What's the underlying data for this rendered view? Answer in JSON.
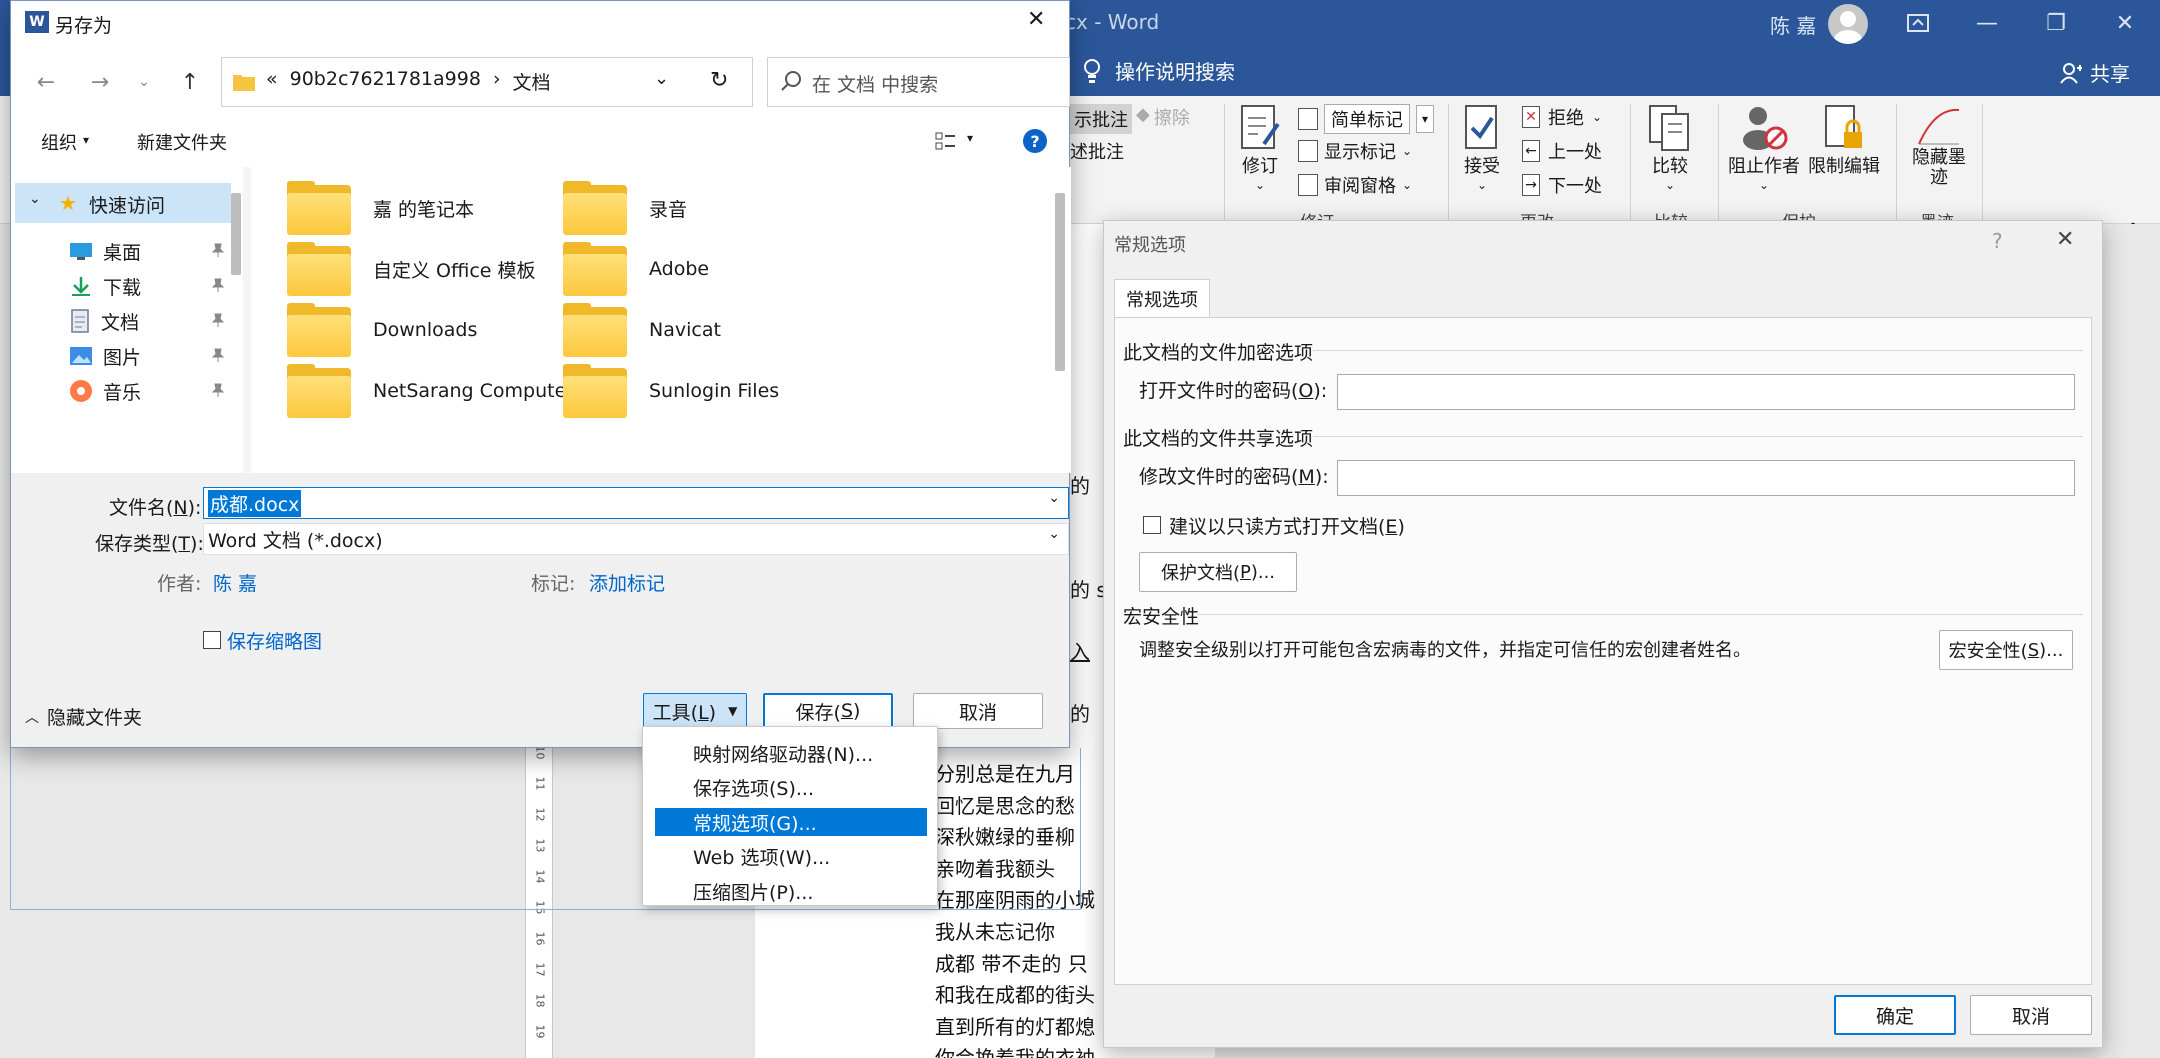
{
  "word": {
    "title": "cx  -  Word",
    "user": "陈 嘉",
    "tell_me": "操作说明搜索",
    "share": "共享",
    "ribbon": {
      "show_comments_fragment": "示批注",
      "delete_label": "擦除",
      "markup_fragment": "述批注",
      "track_changes": "修订",
      "simple_markup": "简单标记",
      "show_markup": "显示标记",
      "reviewing_pane": "审阅窗格",
      "accept": "接受",
      "reject": "拒绝",
      "previous": "上一处",
      "next": "下一处",
      "compare": "比较",
      "block_authors": "阻止作者",
      "restrict_editing": "限制编辑",
      "hide_ink_line1": "隐藏墨",
      "hide_ink_line2": "迹",
      "group_tracking": "修订",
      "group_changes": "更改",
      "group_compare": "比较",
      "group_protect": "保护",
      "group_ink": "墨迹"
    },
    "doc_fragments": [
      "的",
      "的 s",
      "入",
      "的"
    ],
    "doc_lines": [
      "分别总是在九月",
      "回忆是思念的愁",
      "深秋嫩绿的垂柳",
      "亲吻着我额头",
      "在那座阴雨的小城",
      "我从未忘记你",
      "成都  带不走的  只",
      "和我在成都的街头",
      "直到所有的灯都熄",
      "你会挽着我的衣袖"
    ],
    "ruler_numbers": [
      "10",
      "11",
      "12",
      "13",
      "14",
      "15",
      "16",
      "17",
      "18",
      "19"
    ]
  },
  "save_as": {
    "title": "另存为",
    "breadcrumb": {
      "prefix": "«",
      "folder": "90b2c7621781a998",
      "separator": "›",
      "current": "文档"
    },
    "search_placeholder": "在 文档 中搜索",
    "organize": "组织",
    "new_folder": "新建文件夹",
    "help": "?",
    "nav": {
      "quick_access": "快速访问",
      "items": [
        {
          "label": "桌面",
          "icon": "desktop-icon"
        },
        {
          "label": "下载",
          "icon": "download-icon"
        },
        {
          "label": "文档",
          "icon": "document-icon"
        },
        {
          "label": "图片",
          "icon": "pictures-icon"
        },
        {
          "label": "音乐",
          "icon": "music-icon"
        }
      ]
    },
    "files": [
      "嘉 的笔记本",
      "录音",
      "自定义 Office 模板",
      "Adobe",
      "Downloads",
      "Navicat",
      "NetSarang Computer",
      "Sunlogin Files"
    ],
    "filename_label": "文件名(N):",
    "filename_value": "成都.docx",
    "filetype_label": "保存类型(T):",
    "filetype_value": "Word 文档 (*.docx)",
    "author_label": "作者:",
    "author_value": "陈 嘉",
    "tags_label": "标记:",
    "tags_value": "添加标记",
    "thumbnail_label": "保存缩略图",
    "hide_folders": "隐藏文件夹",
    "tools": "工具(L)",
    "save": "保存(S)",
    "cancel": "取消"
  },
  "tools_menu": {
    "items": [
      "映射网络驱动器(N)...",
      "保存选项(S)...",
      "常规选项(G)...",
      "Web 选项(W)...",
      "压缩图片(P)..."
    ],
    "selected_index": 2
  },
  "general_options": {
    "title": "常规选项",
    "help": "?",
    "tab": "常规选项",
    "encrypt_section": "此文档的文件加密选项",
    "open_password_label": "打开文件时的密码(O):",
    "sharing_section": "此文档的文件共享选项",
    "modify_password_label": "修改文件时的密码(M):",
    "readonly_label": "建议以只读方式打开文档(E)",
    "protect_button": "保护文档(P)...",
    "macro_section": "宏安全性",
    "macro_desc": "调整安全级别以打开可能包含宏病毒的文件，并指定可信任的宏创建者姓名。",
    "macro_button": "宏安全性(S)...",
    "ok": "确定",
    "cancel": "取消"
  },
  "colors": {
    "word_blue": "#2b579a",
    "selection_blue": "#0078d7",
    "link_blue": "#0066cc"
  }
}
